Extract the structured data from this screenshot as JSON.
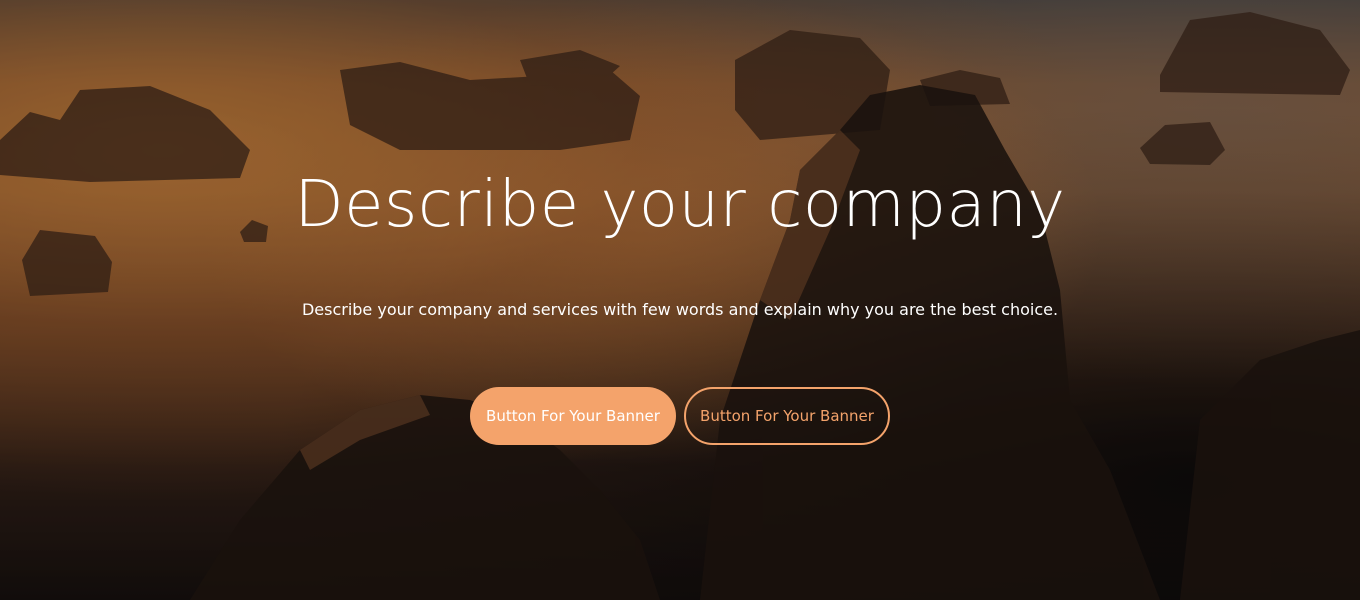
{
  "banner": {
    "title": "Describe your company",
    "subtitle": "Describe your company and services with few words and explain why you are the best choice.",
    "primary_button_label": "Button For Your Banner",
    "secondary_button_label": "Button For Your Banner"
  },
  "colors": {
    "accent": "#f4a36b",
    "text": "#ffffff"
  }
}
